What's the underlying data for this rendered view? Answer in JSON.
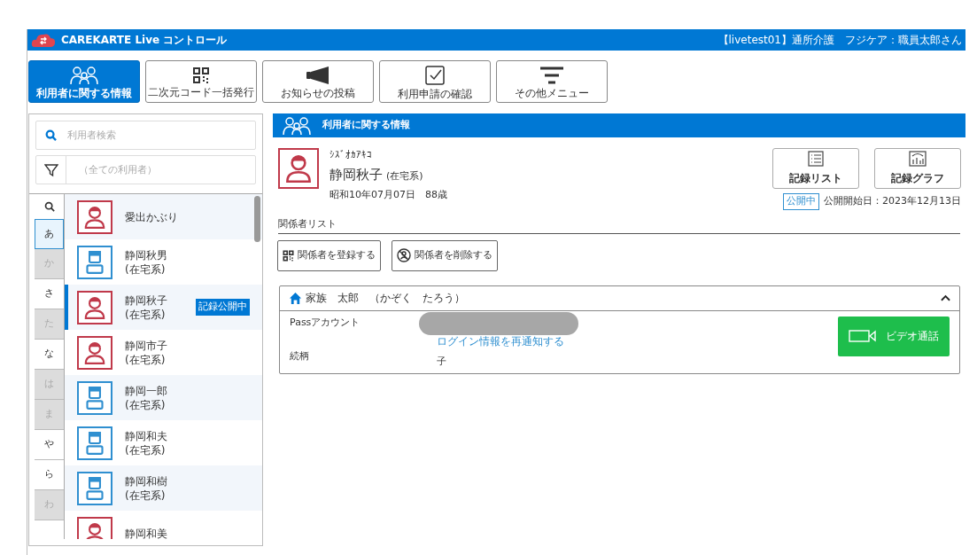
{
  "header": {
    "app_title": "CAREKARTE Live コントロール",
    "user_info": "【livetest01】通所介護　フジケア：職員太郎さん"
  },
  "toolbar": [
    {
      "kind": "users",
      "label": "利用者に関する情報",
      "selected": true
    },
    {
      "kind": "qr",
      "label": "二次元コード一括発行",
      "selected": false
    },
    {
      "kind": "megaphone",
      "label": "お知らせの投稿",
      "selected": false
    },
    {
      "kind": "check",
      "label": "利用申請の確認",
      "selected": false
    },
    {
      "kind": "menu",
      "label": "その他メニュー",
      "selected": false
    }
  ],
  "sidebar": {
    "search": {
      "placeholder": "利用者検索"
    },
    "filter": {
      "placeholder": "（全ての利用者）"
    },
    "index": [
      {
        "label": "あ",
        "selected": true,
        "disabled": false
      },
      {
        "label": "か",
        "selected": false,
        "disabled": true
      },
      {
        "label": "さ",
        "selected": false,
        "disabled": false
      },
      {
        "label": "た",
        "selected": false,
        "disabled": true
      },
      {
        "label": "な",
        "selected": false,
        "disabled": false
      },
      {
        "label": "は",
        "selected": false,
        "disabled": true
      },
      {
        "label": "ま",
        "selected": false,
        "disabled": true
      },
      {
        "label": "や",
        "selected": false,
        "disabled": false
      },
      {
        "label": "ら",
        "selected": false,
        "disabled": false
      },
      {
        "label": "わ",
        "selected": false,
        "disabled": true
      }
    ],
    "users": [
      {
        "kind": "female",
        "name": "愛出かぶり",
        "selected": false
      },
      {
        "kind": "male",
        "name": "静岡秋男",
        "type": "(在宅系)",
        "selected": false
      },
      {
        "kind": "female",
        "name": "静岡秋子",
        "type": "(在宅系)",
        "badge": "記録公開中",
        "selected": true
      },
      {
        "kind": "female",
        "name": "静岡市子",
        "type": "(在宅系)",
        "selected": false
      },
      {
        "kind": "male",
        "name": "静岡一郎",
        "type": "(在宅系)",
        "selected": false
      },
      {
        "kind": "male",
        "name": "静岡和夫",
        "type": "(在宅系)",
        "selected": false
      },
      {
        "kind": "male",
        "name": "静岡和樹",
        "type": "(在宅系)",
        "selected": false
      },
      {
        "kind": "female",
        "name": "静岡和美",
        "selected": false
      }
    ]
  },
  "main": {
    "title": "利用者に関する情報",
    "profile": {
      "kind": "female",
      "kana": "ｼｽﾞｵｶｱｷｺ",
      "name": "静岡秋子",
      "type": "(在宅系)",
      "birth": "昭和10年07月07日　88歳"
    },
    "actions": [
      {
        "kind": "list",
        "label": "記録リスト"
      },
      {
        "kind": "graph",
        "label": "記録グラフ"
      }
    ],
    "publish": {
      "status": "公開中",
      "since": "公開開始日：2023年12月13日"
    },
    "relations_title": "関係者リスト",
    "relation_buttons": [
      {
        "kind": "qr",
        "label": "関係者を登録する"
      },
      {
        "kind": "remove",
        "label": "関係者を削除する"
      }
    ],
    "relation": {
      "name": "家族　太郎　（かぞく　たろう）",
      "expanded": true,
      "rows": [
        {
          "label": "Passアカウント",
          "link": "ログイン情報を再通知する"
        },
        {
          "label": "続柄",
          "value": "子"
        }
      ],
      "video_button": "ビデオ通話"
    }
  }
}
